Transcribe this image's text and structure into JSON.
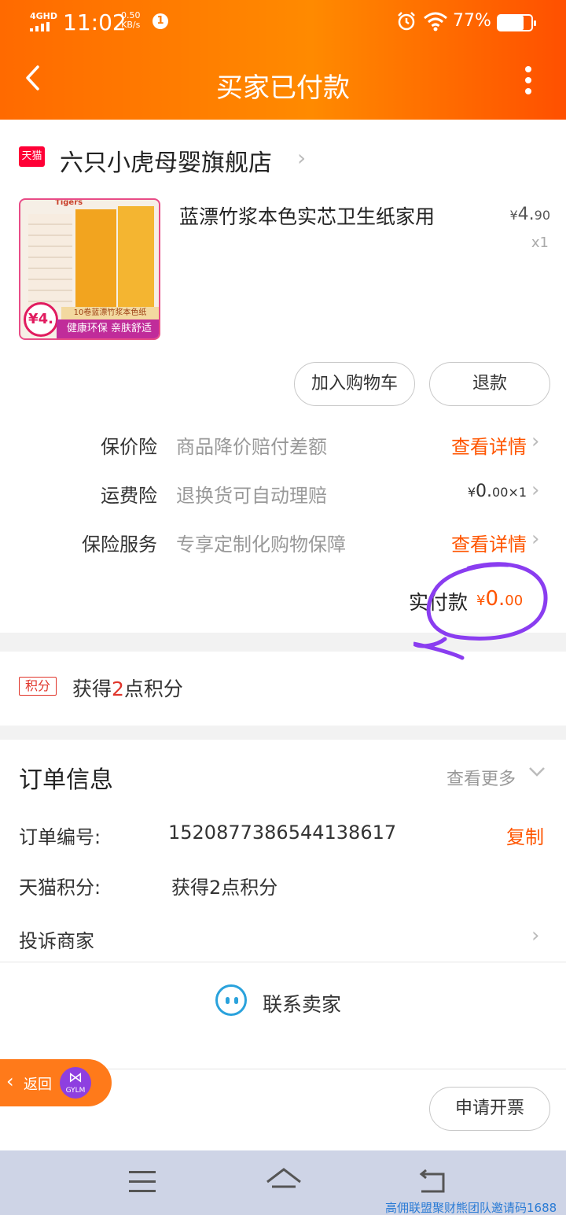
{
  "status_bar": {
    "network": "4GHD",
    "time": "11:02",
    "speed_value": "0.50",
    "speed_unit": "KB/s",
    "notification_count": "1",
    "battery_percent": "77%",
    "battery_level": 0.77,
    "icons": [
      "signal-icon",
      "alarm-icon",
      "wifi-icon",
      "battery-icon"
    ]
  },
  "nav": {
    "title": "买家已付款",
    "back_icon": "chevron-left-icon",
    "more_icon": "more-vertical-icon"
  },
  "shop": {
    "badge": "天猫",
    "name": "六只小虎母婴旗舰店"
  },
  "product": {
    "title": "蓝漂竹浆本色实芯卫生纸家用",
    "price_currency": "¥",
    "price_int": "4.",
    "price_dec": "90",
    "quantity": "x1",
    "image": {
      "brand": "Tigers",
      "badge_price": "¥4.",
      "band_text": "10卷蓝漂竹浆本色纸",
      "slogan": "健康环保 亲肤舒适"
    }
  },
  "actions": {
    "add_to_cart": "加入购物车",
    "refund": "退款"
  },
  "services": [
    {
      "label": "保价险",
      "desc": "商品降价赔付差额",
      "action": "查看详情"
    },
    {
      "label": "运费险",
      "desc": "退换货可自动理赔",
      "value_currency": "¥",
      "value_int": "0.",
      "value_dec": "00",
      "value_mult": "×1"
    },
    {
      "label": "保险服务",
      "desc": "专享定制化购物保障",
      "action": "查看详情"
    }
  ],
  "payment": {
    "label": "实付款",
    "currency": "¥",
    "int": "0.",
    "dec": "00",
    "annotation_color": "#8a3df0"
  },
  "points": {
    "badge": "积分",
    "prefix": "获得",
    "count": "2",
    "suffix": "点积分"
  },
  "order_info": {
    "title": "订单信息",
    "more": "查看更多",
    "order_no_label": "订单编号:",
    "order_no": "1520877386544138617",
    "copy": "复制",
    "points_label": "天猫积分:",
    "points_value": "获得2点积分",
    "complaint": "投诉商家",
    "contact": "联系卖家"
  },
  "float_back": {
    "label": "返回",
    "logo": "GYLM"
  },
  "bottom": {
    "invoice": "申请开票"
  },
  "watermark": "高佣联盟聚财熊团队邀请码1688",
  "colors": {
    "header_orange": "#ff7a00",
    "accent": "#ff5500",
    "tmall_red": "#ff0036"
  }
}
